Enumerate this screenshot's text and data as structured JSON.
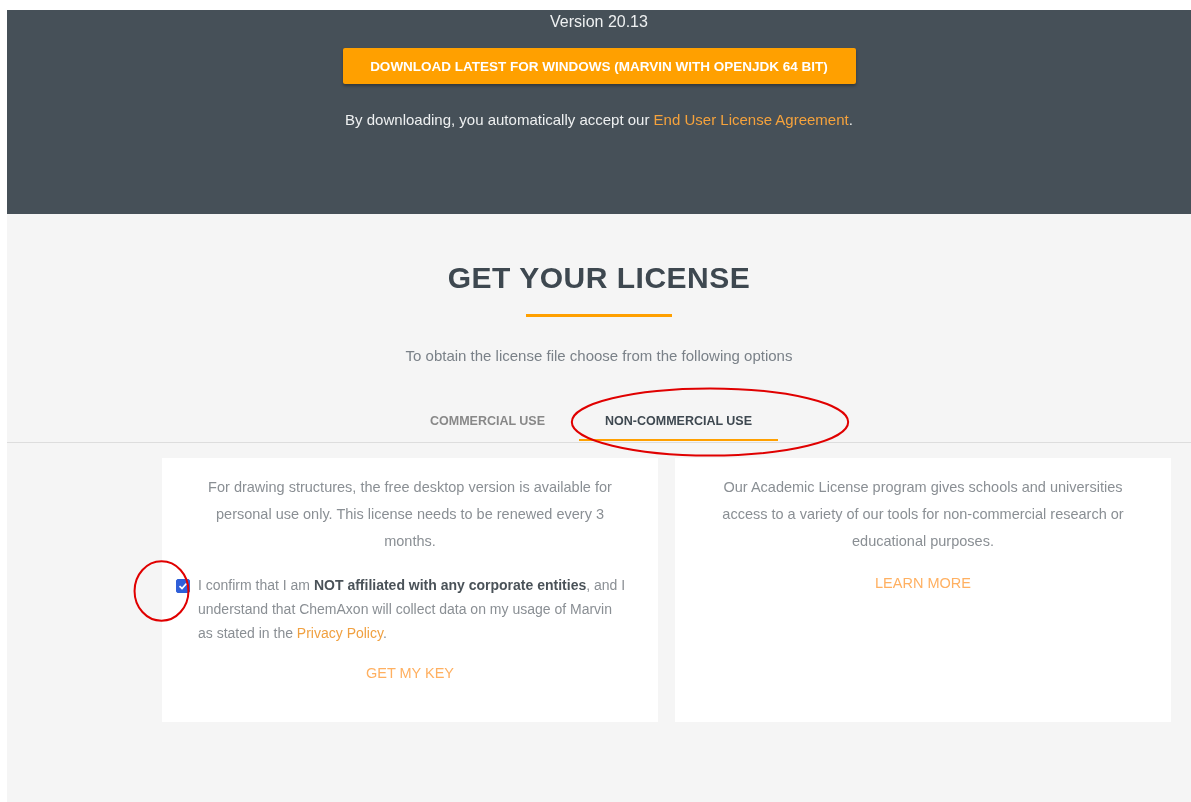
{
  "header": {
    "version": "Version 20.13",
    "download_button": "DOWNLOAD LATEST FOR WINDOWS (MARVIN WITH OPENJDK 64 BIT)",
    "agreement_text": "By downloading, you automatically accept our ",
    "agreement_link": "End User License Agreement",
    "agreement_end": "."
  },
  "license": {
    "title": "GET YOUR LICENSE",
    "subtitle": "To obtain the license file choose from the following options",
    "tabs": [
      {
        "label": "COMMERCIAL USE",
        "selected": false,
        "circled": false
      },
      {
        "label": "NON-COMMERCIAL USE",
        "selected": true,
        "circled": true
      }
    ],
    "cards": [
      {
        "kind": "consent",
        "text": "For drawing structures, the free desktop version is available for personal use only. This license needs to be renewed every 3 months.",
        "checkbox": {
          "checked": true,
          "circled": true,
          "label": "I confirm that I am **NOT affiliated with any corporate entities**, and I understand that ChemAxon will collect data on my usage of Marvin as stated in the ",
          "link": "Privacy Policy",
          "label_end": "."
        },
        "action": "GET MY KEY"
      },
      {
        "kind": "info",
        "text": "Our Academic License program gives schools and universities access to a variety of our tools for non-commercial research or educational purposes.",
        "action": "LEARN MORE"
      }
    ]
  }
}
